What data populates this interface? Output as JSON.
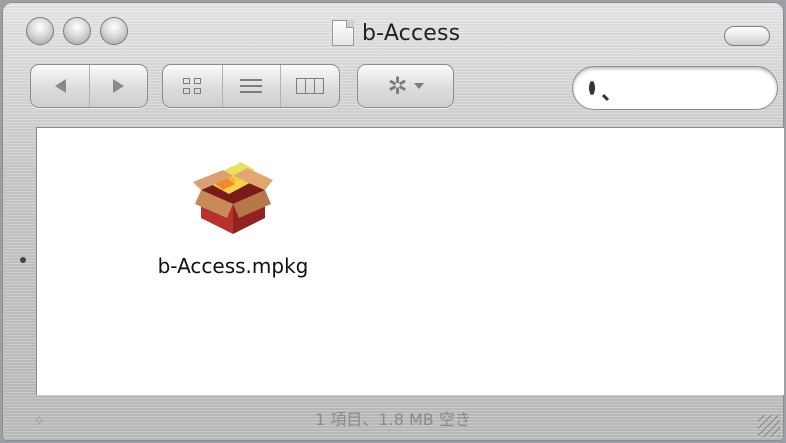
{
  "window": {
    "title": "b-Access",
    "title_icon": "document-icon"
  },
  "toolbar": {
    "back_icon": "back-arrow-icon",
    "forward_icon": "forward-arrow-icon",
    "views": [
      "icon-view-icon",
      "list-view-icon",
      "column-view-icon"
    ],
    "action_icon": "gear-icon",
    "search": {
      "value": "",
      "icon": "search-icon"
    }
  },
  "files": [
    {
      "name": "b-Access.mpkg",
      "icon": "package-icon"
    }
  ],
  "status": {
    "text": "1 項目、1.8 MB 空き"
  },
  "colors": {
    "window_bg": "#c9c9c9",
    "content_bg": "#ffffff",
    "text": "#111111",
    "status_text": "#8a8a8a"
  }
}
